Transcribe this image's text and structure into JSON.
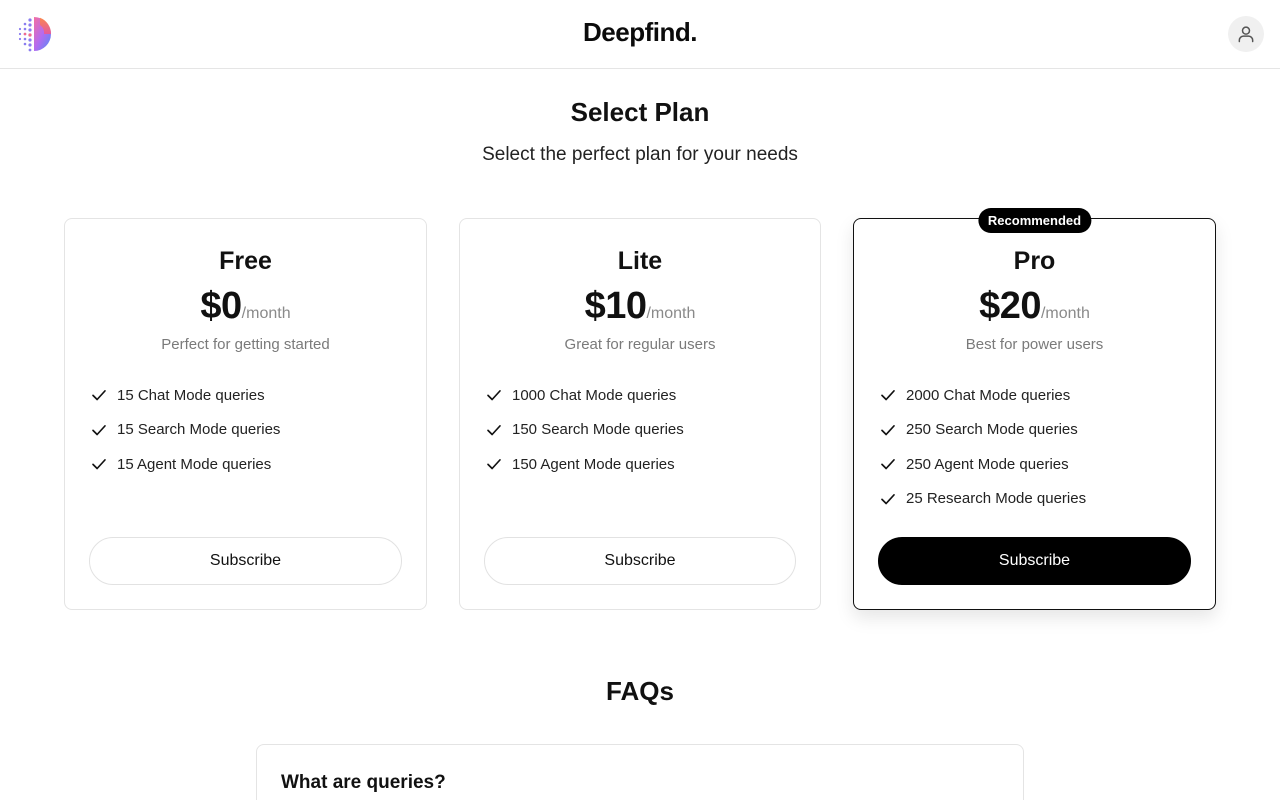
{
  "header": {
    "brand": "Deepfind.",
    "logo_icon": "dotted-half-circle-logo",
    "user_icon": "user-icon"
  },
  "hero": {
    "title": "Select Plan",
    "subtitle": "Select the perfect plan for your needs"
  },
  "plans": [
    {
      "name": "Free",
      "price": "$0",
      "period": "/month",
      "tagline": "Perfect for getting started",
      "features": [
        "15 Chat Mode queries",
        "15 Search Mode queries",
        "15 Agent Mode queries"
      ],
      "button": "Subscribe"
    },
    {
      "name": "Lite",
      "price": "$10",
      "period": "/month",
      "tagline": "Great for regular users",
      "features": [
        "1000 Chat Mode queries",
        "150 Search Mode queries",
        "150 Agent Mode queries"
      ],
      "button": "Subscribe"
    },
    {
      "name": "Pro",
      "badge": "Recommended",
      "price": "$20",
      "period": "/month",
      "tagline": "Best for power users",
      "features": [
        "2000 Chat Mode queries",
        "250 Search Mode queries",
        "250 Agent Mode queries",
        "25 Research Mode queries"
      ],
      "button": "Subscribe"
    }
  ],
  "faq": {
    "title": "FAQs",
    "items": [
      {
        "question": "What are queries?"
      }
    ]
  },
  "colors": {
    "primary_button": "#000000",
    "card_border": "#e4e4e4",
    "muted_text": "#7a7a7a"
  }
}
